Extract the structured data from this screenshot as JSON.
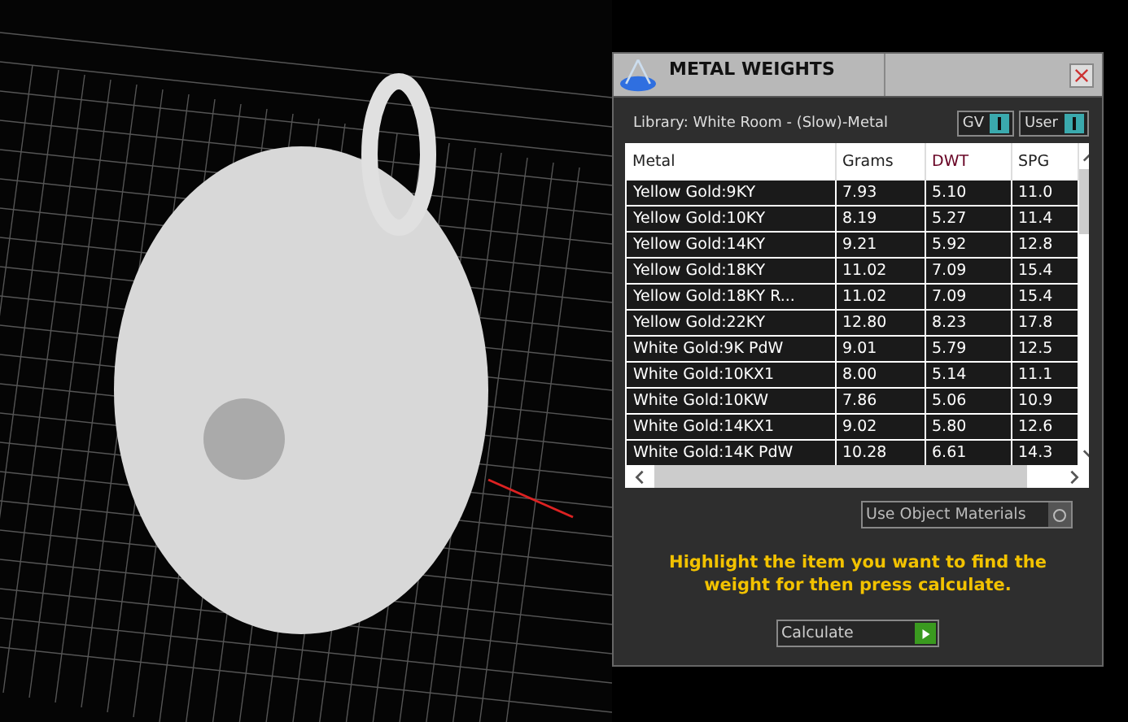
{
  "window": {
    "title": "METAL WEIGHTS"
  },
  "library": {
    "label": "Library: White Room - (Slow)-Metal"
  },
  "toggles": [
    {
      "label": "GV",
      "on": true
    },
    {
      "label": "User",
      "on": true
    }
  ],
  "table": {
    "columns": [
      "Metal",
      "Grams",
      "DWT",
      "SPG"
    ],
    "rows": [
      [
        "Yellow Gold:9KY",
        "7.93",
        "5.10",
        "11.0"
      ],
      [
        "Yellow Gold:10KY",
        "8.19",
        "5.27",
        "11.4"
      ],
      [
        "Yellow Gold:14KY",
        "9.21",
        "5.92",
        "12.8"
      ],
      [
        "Yellow Gold:18KY",
        "11.02",
        "7.09",
        "15.4"
      ],
      [
        "Yellow Gold:18KY R...",
        "11.02",
        "7.09",
        "15.4"
      ],
      [
        "Yellow Gold:22KY",
        "12.80",
        "8.23",
        "17.8"
      ],
      [
        "White Gold:9K PdW",
        "9.01",
        "5.79",
        "12.5"
      ],
      [
        "White Gold:10KX1",
        "8.00",
        "5.14",
        "11.1"
      ],
      [
        "White Gold:10KW",
        "7.86",
        "5.06",
        "10.9"
      ],
      [
        "White Gold:14KX1",
        "9.02",
        "5.80",
        "12.6"
      ],
      [
        "White Gold:14K PdW",
        "10.28",
        "6.61",
        "14.3"
      ]
    ]
  },
  "use_object_materials": {
    "label": "Use Object Materials",
    "checked": false
  },
  "instructions": "Highlight the item you want to find the weight for then press calculate.",
  "calculate_button": {
    "label": "Calculate"
  }
}
